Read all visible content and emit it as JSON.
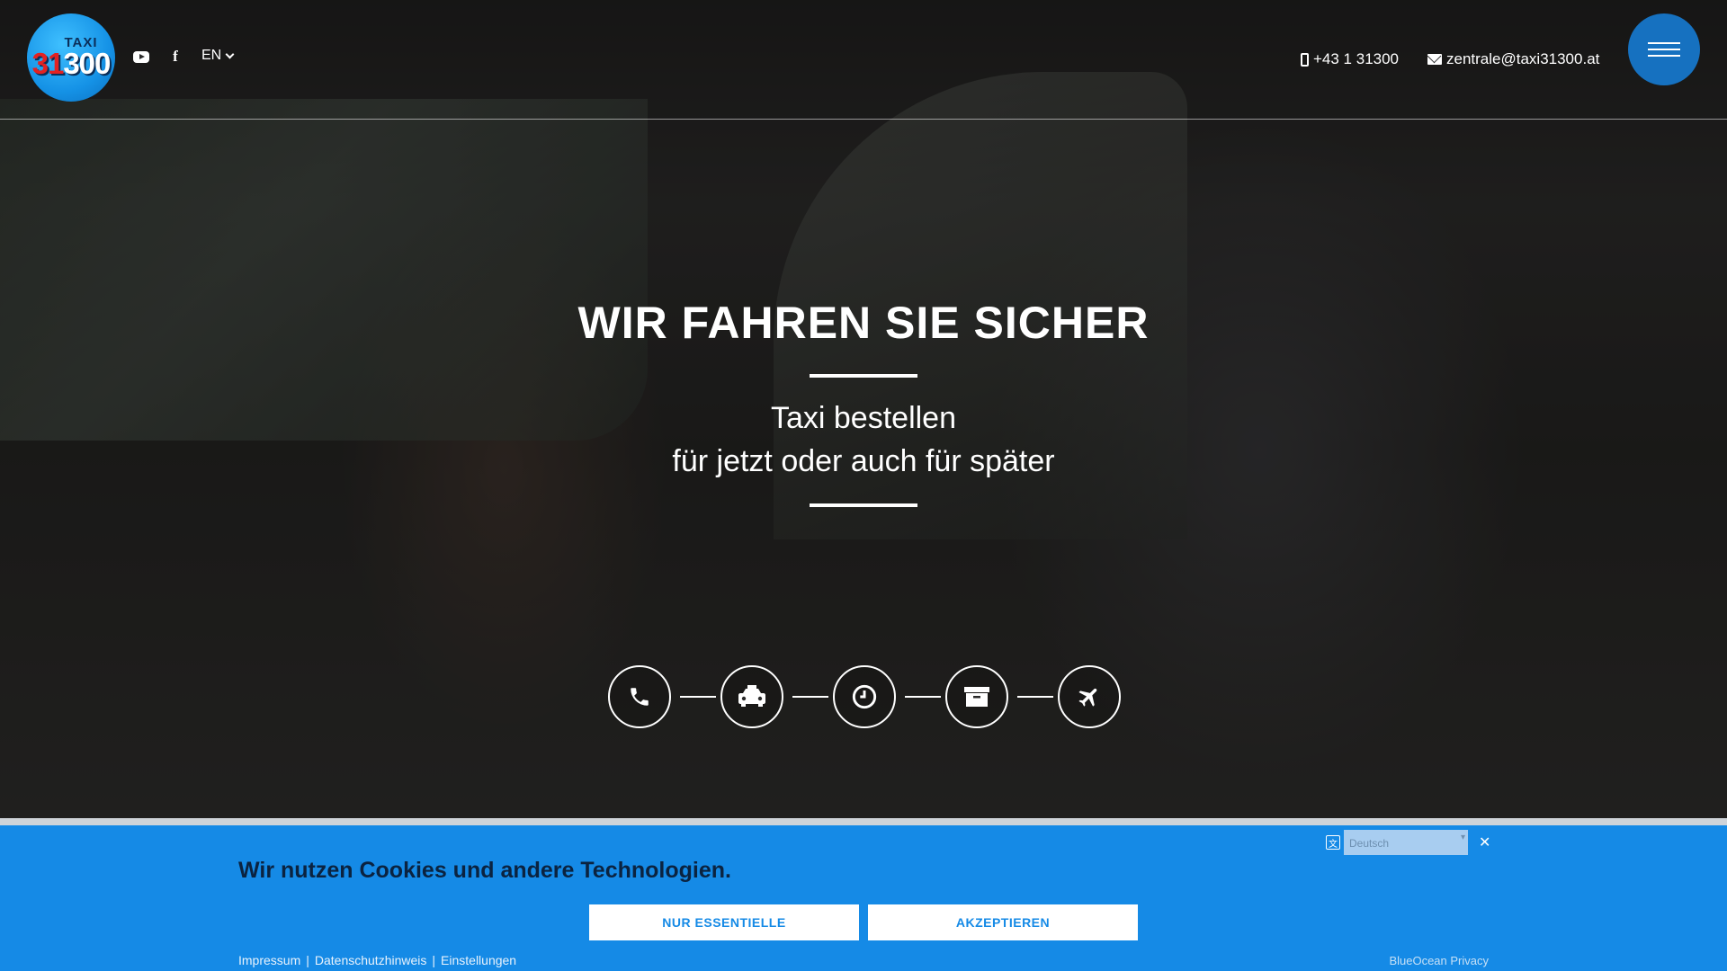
{
  "header": {
    "logo": {
      "top_text": "TAXI",
      "number_prefix": "31",
      "number_suffix": "300"
    },
    "language": "EN",
    "phone": "+43 1 31300",
    "email": "zentrale@taxi31300.at"
  },
  "hero": {
    "headline": "WIR FAHREN SIE SICHER",
    "subline1": "Taxi bestellen",
    "subline2": "für jetzt oder auch für später",
    "steps": [
      {
        "icon": "phone-icon"
      },
      {
        "icon": "taxi-icon"
      },
      {
        "icon": "clock-icon"
      },
      {
        "icon": "archive-icon"
      },
      {
        "icon": "plane-icon"
      }
    ]
  },
  "cookie": {
    "title": "Wir nutzen Cookies und andere Technologien.",
    "btn_essential": "NUR ESSENTIELLE",
    "btn_accept": "AKZEPTIEREN",
    "links": [
      "Impressum",
      "Datenschutzhinweis",
      "Einstellungen"
    ],
    "brand": "BlueOcean Privacy",
    "language_select": "Deutsch"
  },
  "colors": {
    "accent": "#158ae6",
    "menu_button": "#1671c0",
    "cookie_title": "#0b2340"
  }
}
